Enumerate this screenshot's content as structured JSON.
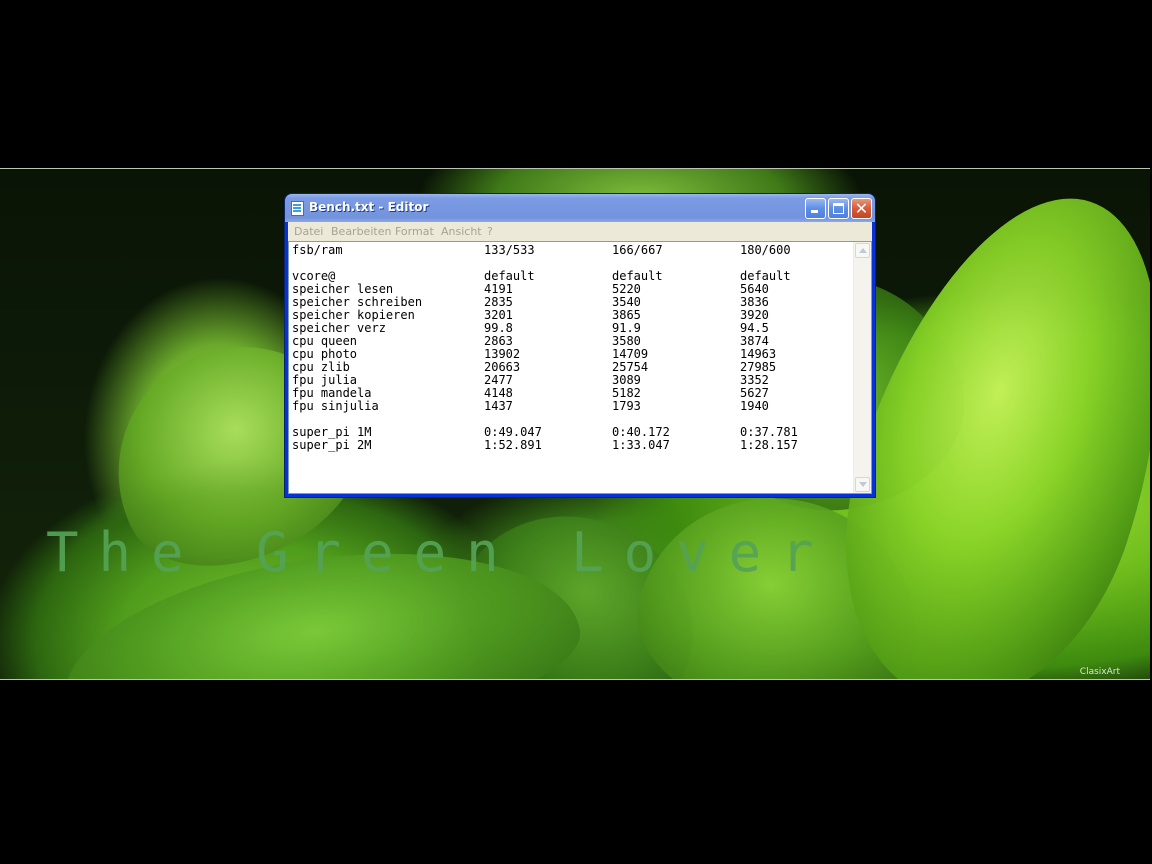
{
  "wallpaper": {
    "tagline": "The Green Lover",
    "signature": "ClasixArt"
  },
  "window": {
    "title": "Bench.txt - Editor",
    "state": "inactive",
    "controls": {
      "minimize": "minimize-icon",
      "maximize": "maximize-icon",
      "close": "close-icon",
      "close_glyph": "✕"
    },
    "menu": [
      "Datei",
      "Bearbeiten",
      "Format",
      "Ansicht",
      "?"
    ]
  },
  "document": {
    "rows": [
      [
        "fsb/ram",
        "133/533",
        "166/667",
        "180/600"
      ],
      [
        "",
        "",
        "",
        ""
      ],
      [
        "vcore@",
        "default",
        "default",
        "default"
      ],
      [
        "speicher lesen",
        "4191",
        "5220",
        "5640"
      ],
      [
        "speicher schreiben",
        "2835",
        "3540",
        "3836"
      ],
      [
        "speicher kopieren",
        "3201",
        "3865",
        "3920"
      ],
      [
        "speicher verz",
        "99.8",
        "91.9",
        "94.5"
      ],
      [
        "cpu queen",
        "2863",
        "3580",
        "3874"
      ],
      [
        "cpu photo",
        "13902",
        "14709",
        "14963"
      ],
      [
        "cpu zlib",
        "20663",
        "25754",
        "27985"
      ],
      [
        "fpu julia",
        "2477",
        "3089",
        "3352"
      ],
      [
        "fpu mandela",
        "4148",
        "5182",
        "5627"
      ],
      [
        "fpu sinjulia",
        "1437",
        "1793",
        "1940"
      ],
      [
        "",
        "",
        "",
        ""
      ],
      [
        "super_pi 1M",
        "0:49.047",
        "0:40.172",
        "0:37.781"
      ],
      [
        "super_pi 2M",
        "1:52.891",
        "1:33.047",
        "1:28.157"
      ]
    ]
  }
}
